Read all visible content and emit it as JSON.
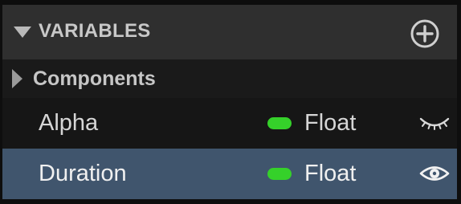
{
  "panel": {
    "header": {
      "title": "VARIABLES",
      "add_icon": "plus-circle-icon",
      "collapse_icon": "triangle-down-icon"
    },
    "category": {
      "label": "Components",
      "expand_icon": "triangle-right-icon"
    },
    "variables": [
      {
        "name": "Alpha",
        "type": "Float",
        "type_color": "#35d12a",
        "visibility_icon": "eye-closed-icon",
        "selected": false
      },
      {
        "name": "Duration",
        "type": "Float",
        "type_color": "#35d12a",
        "visibility_icon": "eye-open-icon",
        "selected": true
      }
    ]
  },
  "colors": {
    "header_bg": "#2f2f2f",
    "selected_row_bg": "#40556d",
    "float_type": "#35d12a"
  }
}
